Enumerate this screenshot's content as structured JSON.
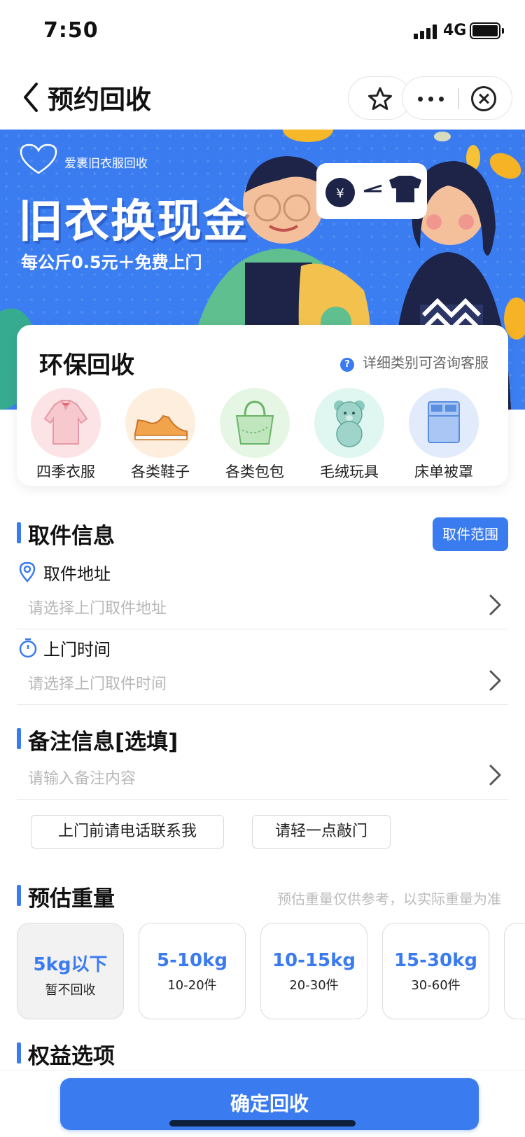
{
  "status_bar": {
    "time": "7:50",
    "network": "4G"
  },
  "nav": {
    "title": "预约回收"
  },
  "banner": {
    "brand_name": "爱裹旧衣服回收",
    "headline": "旧衣换现金",
    "subline": "每公斤0.5元＋免费上门"
  },
  "eco": {
    "title": "环保回收",
    "hint": "详细类别可咨询客服",
    "categories": [
      {
        "label": "四季衣服",
        "icon": "shirt-icon",
        "bg": "#fbe3e6"
      },
      {
        "label": "各类鞋子",
        "icon": "shoe-icon",
        "bg": "#fdeedd"
      },
      {
        "label": "各类包包",
        "icon": "bag-icon",
        "bg": "#e6f6e4"
      },
      {
        "label": "毛绒玩具",
        "icon": "teddy-bear-icon",
        "bg": "#dff6f1"
      },
      {
        "label": "床单被罩",
        "icon": "bedsheet-icon",
        "bg": "#e2ebfb"
      }
    ]
  },
  "pickup": {
    "title": "取件信息",
    "range_button": "取件范围",
    "address_label": "取件地址",
    "address_placeholder": "请选择上门取件地址",
    "time_label": "上门时间",
    "time_placeholder": "请选择上门取件时间"
  },
  "remark": {
    "title": "备注信息[选填]",
    "placeholder": "请输入备注内容",
    "tags": [
      "上门前请电话联系我",
      "请轻一点敲门"
    ]
  },
  "weight": {
    "title": "预估重量",
    "note": "预估重量仅供参考，以实际重量为准",
    "options": [
      {
        "range": "5kg以下",
        "sub": "暂不回收",
        "disabled": true
      },
      {
        "range": "5-10kg",
        "sub": "10-20件",
        "disabled": false
      },
      {
        "range": "10-15kg",
        "sub": "20-30件",
        "disabled": false
      },
      {
        "range": "15-30kg",
        "sub": "30-60件",
        "disabled": false
      }
    ]
  },
  "benefits": {
    "title": "权益选项"
  },
  "confirm_label": "确定回收",
  "colors": {
    "accent": "#3b7bf0",
    "banner_bg": "#3c7ff2"
  }
}
